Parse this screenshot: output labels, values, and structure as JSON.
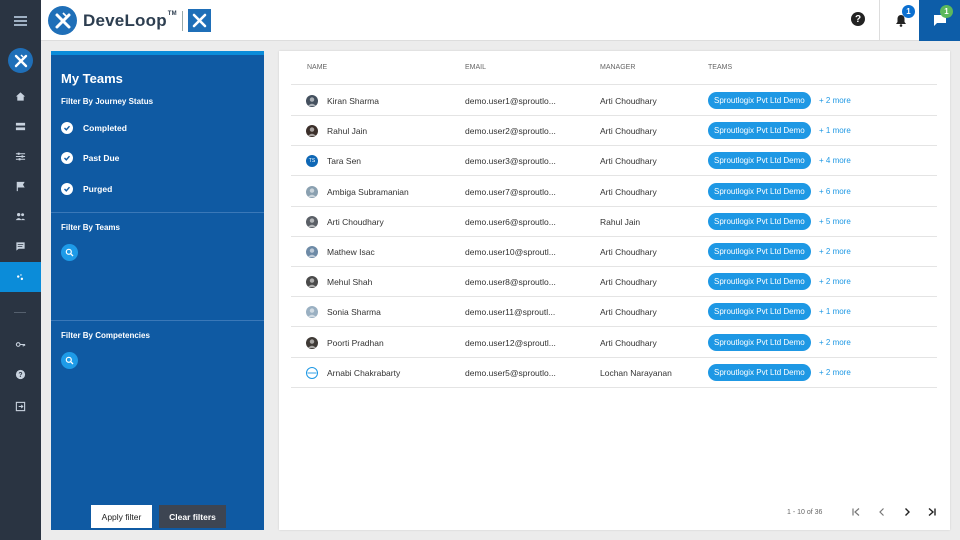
{
  "app": {
    "brand_name": "DeveLoop",
    "trademark": "TM"
  },
  "header": {
    "help_label": "?",
    "notifications_count": "1",
    "messages_count": "1"
  },
  "rail": {
    "items": [
      "home-icon",
      "layers-icon",
      "sliders-icon",
      "flag-icon",
      "people-icon",
      "message-icon",
      "team-icon",
      "key-icon",
      "help-icon",
      "exit-icon"
    ],
    "active_item": "team-icon"
  },
  "filters": {
    "title": "My Teams",
    "journey_status": {
      "label": "Filter By Journey Status",
      "options": [
        {
          "label": "Completed",
          "checked": true
        },
        {
          "label": "Past Due",
          "checked": true
        },
        {
          "label": "Purged",
          "checked": true
        }
      ]
    },
    "teams_label": "Filter By Teams",
    "competencies_label": "Filter By Competencies",
    "apply_label": "Apply filter",
    "clear_label": "Clear filters"
  },
  "table": {
    "columns": [
      "Name",
      "Email",
      "Manager",
      "Teams"
    ],
    "rows": [
      {
        "name": "Kiran Sharma",
        "email": "demo.user1@sproutlo...",
        "manager": "Arti Choudhary",
        "team": "Sproutlogix Pvt Ltd Demo",
        "more": "+ 2 more",
        "avatar": "photo"
      },
      {
        "name": "Rahul Jain",
        "email": "demo.user2@sproutlo...",
        "manager": "Arti Choudhary",
        "team": "Sproutlogix Pvt Ltd Demo",
        "more": "+ 1 more",
        "avatar": "photo"
      },
      {
        "name": "Tara Sen",
        "email": "demo.user3@sproutlo...",
        "manager": "Arti Choudhary",
        "team": "Sproutlogix Pvt Ltd Demo",
        "more": "+ 4 more",
        "avatar": "TS"
      },
      {
        "name": "Ambiga Subramanian",
        "email": "demo.user7@sproutlo...",
        "manager": "Arti Choudhary",
        "team": "Sproutlogix Pvt Ltd Demo",
        "more": "+ 6 more",
        "avatar": "photo"
      },
      {
        "name": "Arti Choudhary",
        "email": "demo.user6@sproutlo...",
        "manager": "Rahul Jain",
        "team": "Sproutlogix Pvt Ltd Demo",
        "more": "+ 5 more",
        "avatar": "photo"
      },
      {
        "name": "Mathew Isac",
        "email": "demo.user10@sproutl...",
        "manager": "Arti Choudhary",
        "team": "Sproutlogix Pvt Ltd Demo",
        "more": "+ 2 more",
        "avatar": "photo"
      },
      {
        "name": "Mehul Shah",
        "email": "demo.user8@sproutlo...",
        "manager": "Arti Choudhary",
        "team": "Sproutlogix Pvt Ltd Demo",
        "more": "+ 2 more",
        "avatar": "photo"
      },
      {
        "name": "Sonia Sharma",
        "email": "demo.user11@sproutl...",
        "manager": "Arti Choudhary",
        "team": "Sproutlogix Pvt Ltd Demo",
        "more": "+ 1 more",
        "avatar": "photo"
      },
      {
        "name": "Poorti Pradhan",
        "email": "demo.user12@sproutl...",
        "manager": "Arti Choudhary",
        "team": "Sproutlogix Pvt Ltd Demo",
        "more": "+ 2 more",
        "avatar": "photo"
      },
      {
        "name": "Arnabi Chakrabarty",
        "email": "demo.user5@sproutlo...",
        "manager": "Lochan Narayanan",
        "team": "Sproutlogix Pvt Ltd Demo",
        "more": "+ 2 more",
        "avatar": "globe"
      }
    ]
  },
  "pagination": {
    "info": "1 - 10 of 36"
  },
  "colors": {
    "rail": "#2a3442",
    "panel": "#0f5aa3",
    "accent": "#1e98e4",
    "active": "#0b8cd9"
  }
}
